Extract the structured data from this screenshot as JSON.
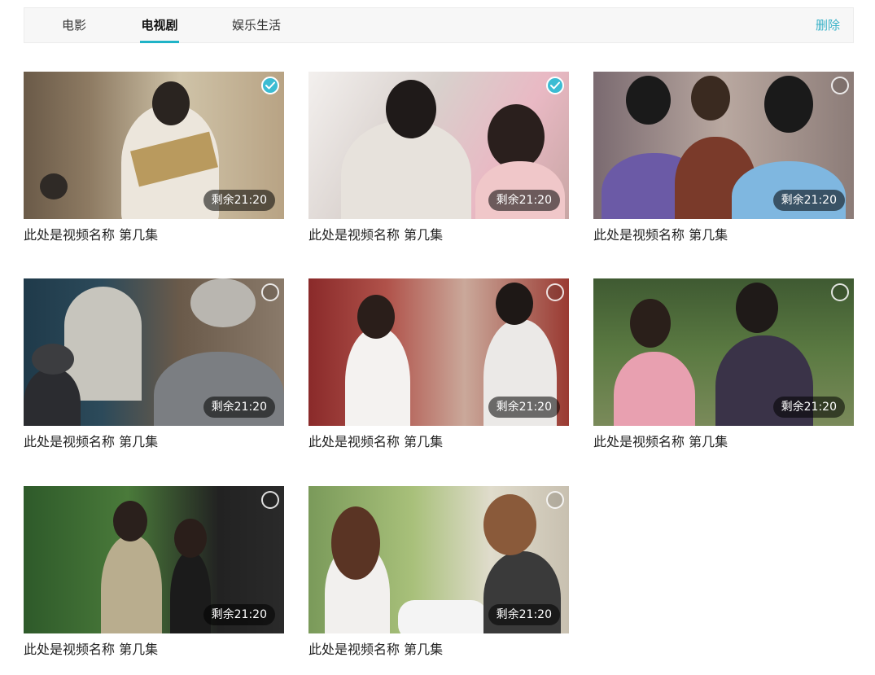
{
  "tabs": [
    {
      "label": "电影",
      "active": false
    },
    {
      "label": "电视剧",
      "active": true
    },
    {
      "label": "娱乐生活",
      "active": false
    }
  ],
  "delete_label": "删除",
  "accent_color": "#1fb3c7",
  "videos": [
    {
      "title": "此处是视频名称 第几集",
      "remaining": "剩余21:20",
      "selected": true
    },
    {
      "title": "此处是视频名称 第几集",
      "remaining": "剩余21:20",
      "selected": true
    },
    {
      "title": "此处是视频名称 第几集",
      "remaining": "剩余21:20",
      "selected": false
    },
    {
      "title": "此处是视频名称 第几集",
      "remaining": "剩余21:20",
      "selected": false
    },
    {
      "title": "此处是视频名称 第几集",
      "remaining": "剩余21:20",
      "selected": false
    },
    {
      "title": "此处是视频名称 第几集",
      "remaining": "剩余21:20",
      "selected": false
    },
    {
      "title": "此处是视频名称 第几集",
      "remaining": "剩余21:20",
      "selected": false
    },
    {
      "title": "此处是视频名称 第几集",
      "remaining": "剩余21:20",
      "selected": false
    }
  ]
}
